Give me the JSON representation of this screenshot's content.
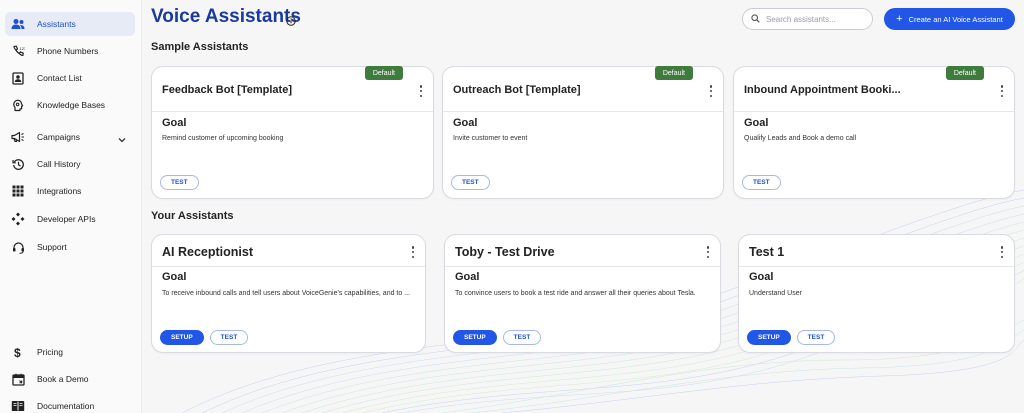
{
  "sidebar": {
    "items": [
      {
        "label": "Assistants",
        "icon": "users-icon",
        "active": true
      },
      {
        "label": "Phone Numbers",
        "icon": "phone-icon"
      },
      {
        "label": "Contact List",
        "icon": "contact-card-icon"
      },
      {
        "label": "Knowledge Bases",
        "icon": "brain-icon"
      },
      {
        "label": "Campaigns",
        "icon": "megaphone-icon"
      },
      {
        "label": "Call History",
        "icon": "history-icon"
      },
      {
        "label": "Integrations",
        "icon": "grid-icon"
      },
      {
        "label": "Developer APIs",
        "icon": "api-icon"
      },
      {
        "label": "Support",
        "icon": "headset-icon"
      }
    ],
    "bottom_items": [
      {
        "label": "Pricing",
        "icon": "dollar-icon"
      },
      {
        "label": "Book a Demo",
        "icon": "calendar-icon"
      },
      {
        "label": "Documentation",
        "icon": "book-icon"
      }
    ]
  },
  "header": {
    "title": "Voice Assistants",
    "search_placeholder": "Search assistants...",
    "create_label": "Create an AI Voice Assistant"
  },
  "sections": {
    "sample_title": "Sample Assistants",
    "yours_title": "Your Assistants"
  },
  "sample_assistants": [
    {
      "name": "Feedback Bot [Template]",
      "badge": "Default",
      "goal_label": "Goal",
      "goal": "Remind customer of upcoming booking",
      "test_label": "TEST"
    },
    {
      "name": "Outreach Bot [Template]",
      "badge": "Default",
      "goal_label": "Goal",
      "goal": "Invite customer to event",
      "test_label": "TEST"
    },
    {
      "name": "Inbound Appointment Booki...",
      "badge": "Default",
      "goal_label": "Goal",
      "goal": "Qualify Leads and Book a demo call",
      "test_label": "TEST"
    }
  ],
  "your_assistants": [
    {
      "name": "AI Receptionist",
      "goal_label": "Goal",
      "goal": "To receive inbound calls and tell users about VoiceGenie's capabilities, and to ...",
      "setup_label": "SETUP",
      "test_label": "TEST"
    },
    {
      "name": "Toby - Test Drive",
      "goal_label": "Goal",
      "goal": "To convince users to book a test ride and answer all their queries about Tesla.",
      "setup_label": "SETUP",
      "test_label": "TEST"
    },
    {
      "name": "Test 1",
      "goal_label": "Goal",
      "goal": "Understand User",
      "setup_label": "SETUP",
      "test_label": "TEST"
    }
  ],
  "colors": {
    "accent": "#2156e6",
    "title": "#1a3a9e",
    "badge": "#3e7b3c",
    "active_bg": "#e6ebf5"
  }
}
